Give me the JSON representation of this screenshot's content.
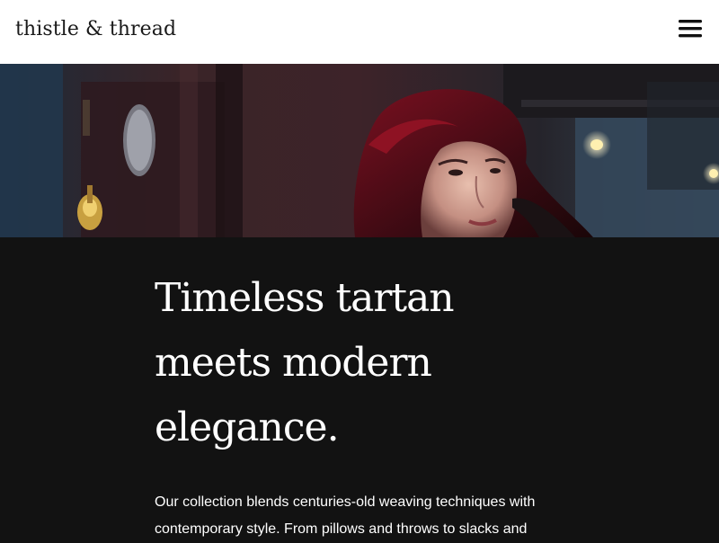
{
  "header": {
    "brand": "thistle & thread",
    "menu_icon": "hamburger-menu-icon"
  },
  "hero": {
    "image": "woman-with-dark-red-hair-portrait"
  },
  "main": {
    "headline": "Timeless tartan meets modern elegance.",
    "intro": "Our collection blends centuries-old weaving techniques with contemporary style. From pillows and throws to slacks and"
  },
  "colors": {
    "header_bg": "#ffffff",
    "brand_text": "#1a1a1a",
    "content_bg": "#121212",
    "content_text": "#ffffff"
  }
}
